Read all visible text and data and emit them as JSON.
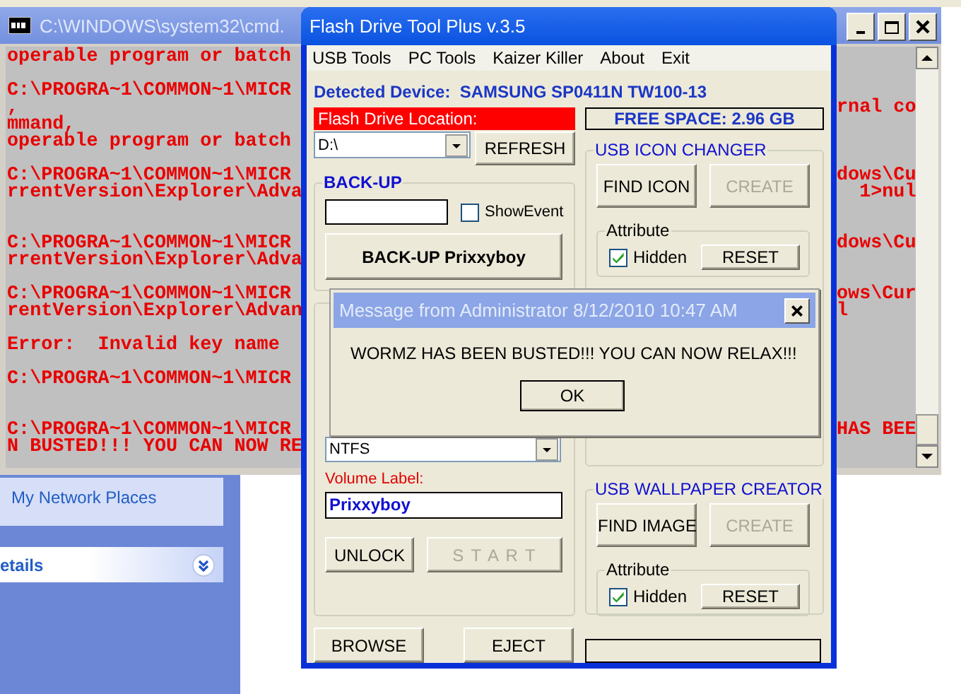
{
  "cmd_window": {
    "title": "C:\\WINDOWS\\system32\\cmd.",
    "lines": [
      {
        "kind": "text",
        "left": "operable program or batch"
      },
      {
        "kind": "blank"
      },
      {
        "kind": "text",
        "left": "C:\\PROGRA~1\\COMMON~1\\MICR"
      },
      {
        "kind": "text",
        "left": ",",
        "right": "rnal co"
      },
      {
        "kind": "text",
        "left": "mmand,"
      },
      {
        "kind": "text",
        "left": "operable program or batch"
      },
      {
        "kind": "blank"
      },
      {
        "kind": "text",
        "left": "C:\\PROGRA~1\\COMMON~1\\MICR",
        "right": "dows\\Cu"
      },
      {
        "kind": "text",
        "left": "rrentVersion\\Explorer\\Adva",
        "right": "  1>nul"
      },
      {
        "kind": "blank"
      },
      {
        "kind": "blank"
      },
      {
        "kind": "text",
        "left": "C:\\PROGRA~1\\COMMON~1\\MICR",
        "right": "dows\\Cu"
      },
      {
        "kind": "text",
        "left": "rrentVersion\\Explorer\\Adva"
      },
      {
        "kind": "blank"
      },
      {
        "kind": "text",
        "left": "C:\\PROGRA~1\\COMMON~1\\MICR",
        "right": "ows\\Cur"
      },
      {
        "kind": "text",
        "left": "rentVersion\\Explorer\\Advan",
        "right": "l"
      },
      {
        "kind": "blank"
      },
      {
        "kind": "text",
        "left": "Error:  Invalid key name"
      },
      {
        "kind": "blank"
      },
      {
        "kind": "text",
        "left": "C:\\PROGRA~1\\COMMON~1\\MICR"
      },
      {
        "kind": "blank"
      },
      {
        "kind": "blank"
      },
      {
        "kind": "text",
        "left": "C:\\PROGRA~1\\COMMON~1\\MICR",
        "right": "HAS BEE"
      },
      {
        "kind": "text",
        "left": "N BUSTED!!! YOU CAN NOW RE"
      }
    ]
  },
  "explorer_pane": {
    "item": "My Network Places",
    "section_title": "etails"
  },
  "app_window": {
    "title": "Flash Drive Tool Plus  v.3.5",
    "menu": [
      "USB Tools",
      "PC Tools",
      "Kaizer Killer",
      "About",
      "Exit"
    ],
    "detected_device": "Detected Device:  SAMSUNG SP0411N TW100-13",
    "location_label": "Flash Drive Location:",
    "free_space": "FREE SPACE: 2.96 GB",
    "drive_select": "D:\\",
    "refresh_button": "REFRESH",
    "backup": {
      "title": "BACK-UP",
      "show_event": {
        "label": "ShowEvent",
        "checked": false
      },
      "button": "BACK-UP Prixxyboy"
    },
    "format": {
      "filesystem": "NTFS",
      "volume_label": "Volume  Label:",
      "volume_value": "Prixxyboy",
      "unlock_button": "UNLOCK",
      "start_button": {
        "label": "S T A R T",
        "disabled": true
      }
    },
    "icon_changer": {
      "title": "USB ICON CHANGER",
      "find_button": "FIND ICON",
      "create_button": {
        "label": "CREATE",
        "disabled": true
      },
      "attribute": {
        "title": "Attribute",
        "hidden": {
          "label": "Hidden",
          "checked": true
        },
        "reset_button": "RESET"
      }
    },
    "wallpaper_creator": {
      "title": "USB WALLPAPER CREATOR",
      "find_button": "FIND IMAGE",
      "create_button": {
        "label": "CREATE",
        "disabled": true
      },
      "attribute": {
        "title": "Attribute",
        "hidden": {
          "label": "Hidden",
          "checked": true
        },
        "reset_button": "RESET"
      }
    },
    "browse_button": "BROWSE",
    "eject_button": "EJECT"
  },
  "dialog": {
    "title": "Message from Administrator 8/12/2010 10:47 AM",
    "message": "WORMZ HAS BEEN BUSTED!!! YOU CAN NOW RELAX!!!",
    "ok_button": "OK"
  }
}
